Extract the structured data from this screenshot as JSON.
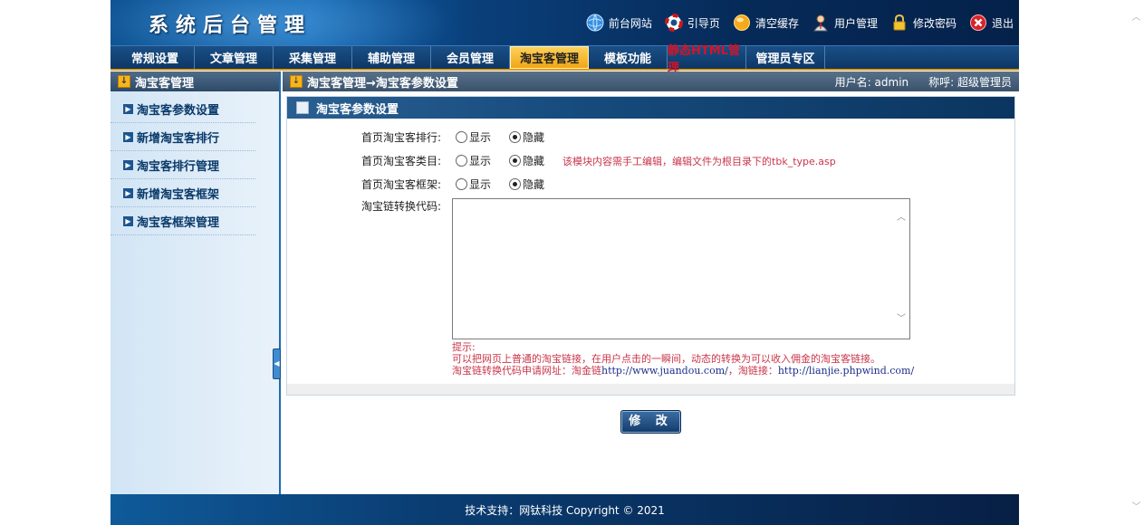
{
  "header": {
    "title": "系统后台管理",
    "links": [
      {
        "label": "前台网站",
        "icon": "globe-icon"
      },
      {
        "label": "引导页",
        "icon": "lifebuoy-icon"
      },
      {
        "label": "清空缓存",
        "icon": "orange-circle-icon"
      },
      {
        "label": "用户管理",
        "icon": "user-icon"
      },
      {
        "label": "修改密码",
        "icon": "lock-icon"
      },
      {
        "label": "退出",
        "icon": "exit-icon"
      }
    ]
  },
  "nav": {
    "items": [
      "常规设置",
      "文章管理",
      "采集管理",
      "辅助管理",
      "会员管理",
      "淘宝客管理",
      "模板功能",
      "静态HTML管理",
      "管理员专区"
    ],
    "active": "淘宝客管理",
    "highlighted": "静态HTML管理"
  },
  "sidebar": {
    "title": "淘宝客管理",
    "items": [
      "淘宝客参数设置",
      "新增淘宝客排行",
      "淘宝客排行管理",
      "新增淘宝客框架",
      "淘宝客框架管理"
    ]
  },
  "crumb": {
    "path": "淘宝客管理→淘宝客参数设置",
    "user": "用户名: admin",
    "role": "称呼: 超级管理员"
  },
  "panel": {
    "title": "淘宝客参数设置",
    "rows": [
      {
        "label": "首页淘宝客排行:",
        "show": "显示",
        "hide": "隐藏",
        "selected": "隐藏"
      },
      {
        "label": "首页淘宝客类目:",
        "show": "显示",
        "hide": "隐藏",
        "selected": "隐藏",
        "note": "该模块内容需手工编辑，编辑文件为根目录下的tbk_type.asp"
      },
      {
        "label": "首页淘宝客框架:",
        "show": "显示",
        "hide": "隐藏",
        "selected": "隐藏"
      }
    ],
    "code_label": "淘宝链转换代码:",
    "code_value": "",
    "hints": {
      "line1": "提示:",
      "line2": "可以把网页上普通的淘宝链接，在用户点击的一瞬间，动态的转换为可以收入佣金的淘宝客链接。",
      "line3_prefix": "淘宝链转换代码申请网址：淘金链",
      "line3_url1": "http://www.juandou.com/",
      "line3_mid": "，淘链接：",
      "line3_url2": "http://lianjie.phpwind.com/"
    },
    "submit": "修 改"
  },
  "footer": {
    "text": "技术支持：网钛科技 Copyright © 2021"
  },
  "colors": {
    "nav_active": "#f2a516",
    "nav_highlight": "#d1152a",
    "hint_red": "#c9364b"
  }
}
